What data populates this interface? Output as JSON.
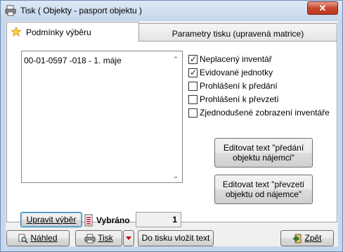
{
  "window": {
    "title": "Tisk ( Objekty - pasport objektu )",
    "close_glyph": "✕",
    "icon": "print-icon"
  },
  "tabs": [
    {
      "label": "Podmínky výběru",
      "active": true,
      "icon": "star-icon"
    },
    {
      "label": "Parametry tisku (upravená matrice)",
      "active": false
    }
  ],
  "list": {
    "items": [
      "00-01-0597 -018 - 1. máje"
    ],
    "scroll_up": "⌃",
    "scroll_down": "⌄"
  },
  "checkboxes": [
    {
      "label": "Neplacený inventář",
      "checked": true
    },
    {
      "label": "Evidované jednotky",
      "checked": true
    },
    {
      "label": "Prohlášení k předání",
      "checked": false
    },
    {
      "label": "Prohlášení k převzetí",
      "checked": false
    },
    {
      "label": "Zjednodušené zobrazení inventáře",
      "checked": false
    }
  ],
  "edit_buttons": {
    "edit_handover_line1": "Editovat text \"předání",
    "edit_handover_line2": "objektu nájemci\"",
    "edit_takeover_line1": "Editovat text \"převzetí",
    "edit_takeover_line2": "objektu od nájemce\""
  },
  "selection": {
    "edit_button": "Upravit výběr",
    "selected_label": "Vybráno",
    "selected_count": "1"
  },
  "footer": {
    "preview": "Náhled",
    "print": "Tisk",
    "insert_to_print": "Do tisku vložit text",
    "back": "Zpět"
  },
  "colors": {
    "accent_red": "#c9462b",
    "focus_blue": "#3c7fb1",
    "title_bar": "#c5d7ec"
  }
}
